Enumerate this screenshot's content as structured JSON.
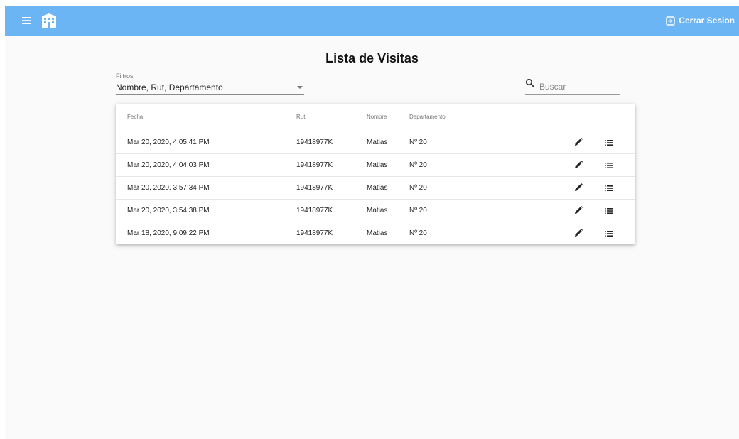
{
  "topbar": {
    "menu_icon": "menu-icon",
    "home_icon": "building-icon",
    "logout_icon": "exit-icon",
    "logout_label": "Cerrar Sesion",
    "color": "#6cb5f5"
  },
  "page": {
    "title": "Lista de Visitas"
  },
  "filter": {
    "label": "Filtros",
    "value": "Nombre, Rut, Departamento"
  },
  "search": {
    "placeholder": "Buscar",
    "value": ""
  },
  "table": {
    "headers": {
      "fecha": "Fecha",
      "rut": "Rut",
      "nombre": "Nombre",
      "departamento": "Departamento"
    },
    "rows": [
      {
        "fecha": "Mar 20, 2020, 4:05:41 PM",
        "rut": "19418977K",
        "nombre": "Matias",
        "departamento": "Nº 20"
      },
      {
        "fecha": "Mar 20, 2020, 4:04:03 PM",
        "rut": "19418977K",
        "nombre": "Matias",
        "departamento": "Nº 20"
      },
      {
        "fecha": "Mar 20, 2020, 3:57:34 PM",
        "rut": "19418977K",
        "nombre": "Matias",
        "departamento": "Nº 20"
      },
      {
        "fecha": "Mar 20, 2020, 3:54:38 PM",
        "rut": "19418977K",
        "nombre": "Matias",
        "departamento": "Nº 20"
      },
      {
        "fecha": "Mar 18, 2020, 9:09:22 PM",
        "rut": "19418977K",
        "nombre": "Matias",
        "departamento": "Nº 20"
      }
    ],
    "row_action_icons": [
      "pencil-icon",
      "list-icon"
    ]
  }
}
